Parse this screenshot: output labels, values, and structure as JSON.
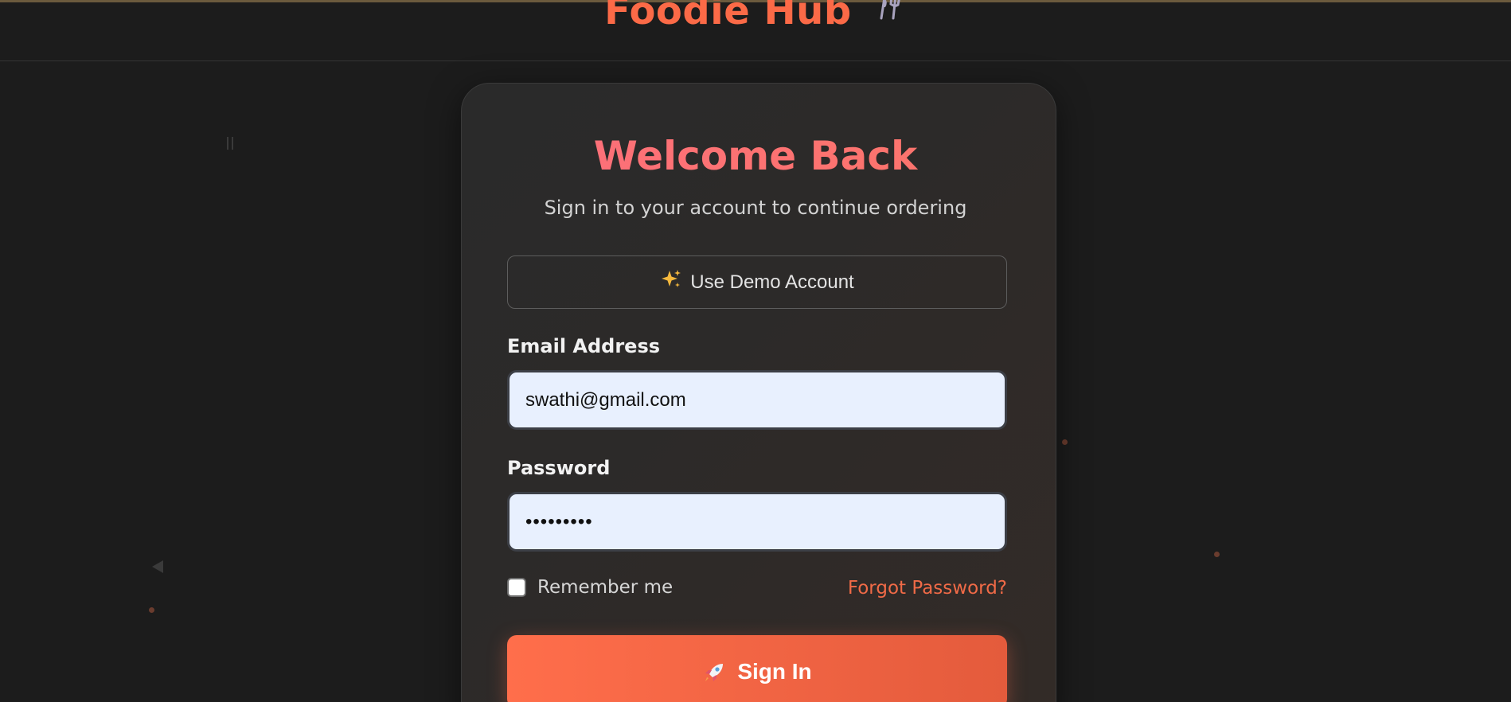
{
  "header": {
    "brand": "Foodie Hub",
    "brand_icon": "fork-knife-icon"
  },
  "login": {
    "title": "Welcome Back",
    "subtitle": "Sign in to your account to continue ordering",
    "demo_button_label": "Use Demo Account",
    "demo_button_icon": "sparkles-icon",
    "email_label": "Email Address",
    "email_value": "swathi@gmail.com",
    "password_label": "Password",
    "password_value": "•••••••••",
    "remember_label": "Remember me",
    "remember_checked": false,
    "forgot_label": "Forgot Password?",
    "signin_label": "Sign In",
    "signin_icon": "rocket-icon"
  },
  "colors": {
    "background": "#1c1c1c",
    "accent": "#fb6a47",
    "title_gradient_start": "#ff6a8b",
    "title_gradient_end": "#f97a5a",
    "input_background": "#e8f0fe"
  }
}
